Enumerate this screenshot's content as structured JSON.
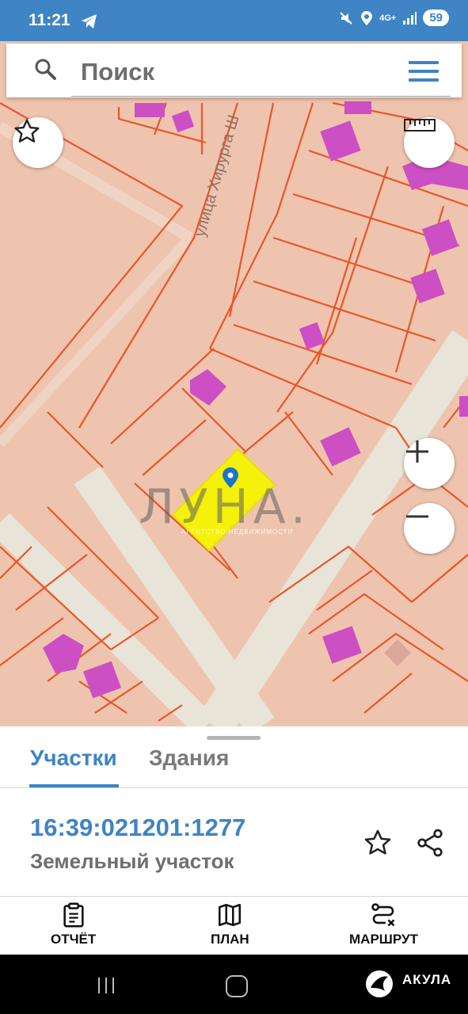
{
  "status_bar": {
    "time": "11:21",
    "network": "4G+",
    "battery": "59"
  },
  "search": {
    "placeholder": "Поиск"
  },
  "map": {
    "street_label": "улица Хирурга Ш",
    "watermark_title": "ЛУНА.",
    "watermark_subtitle": "АГЕНТСТВО НЕДВИЖИМОСТИ",
    "colors": {
      "background": "#efc4ae",
      "parcel_border": "#e8562a",
      "building": "#cc4fc4",
      "road": "#e9e4d8",
      "selected": "#f5f10a"
    }
  },
  "sheet": {
    "tabs": [
      {
        "label": "Участки",
        "active": true
      },
      {
        "label": "Здания",
        "active": false
      }
    ],
    "cadastral_number": "16:39:021201:1277",
    "parcel_type": "Земельный участок"
  },
  "bottom_nav": [
    {
      "label": "ОТЧЁТ",
      "icon": "clipboard-icon"
    },
    {
      "label": "ПЛАН",
      "icon": "map-icon"
    },
    {
      "label": "МАРШРУТ",
      "icon": "route-icon"
    }
  ],
  "system_nav": {
    "brand": "АКУЛА"
  }
}
